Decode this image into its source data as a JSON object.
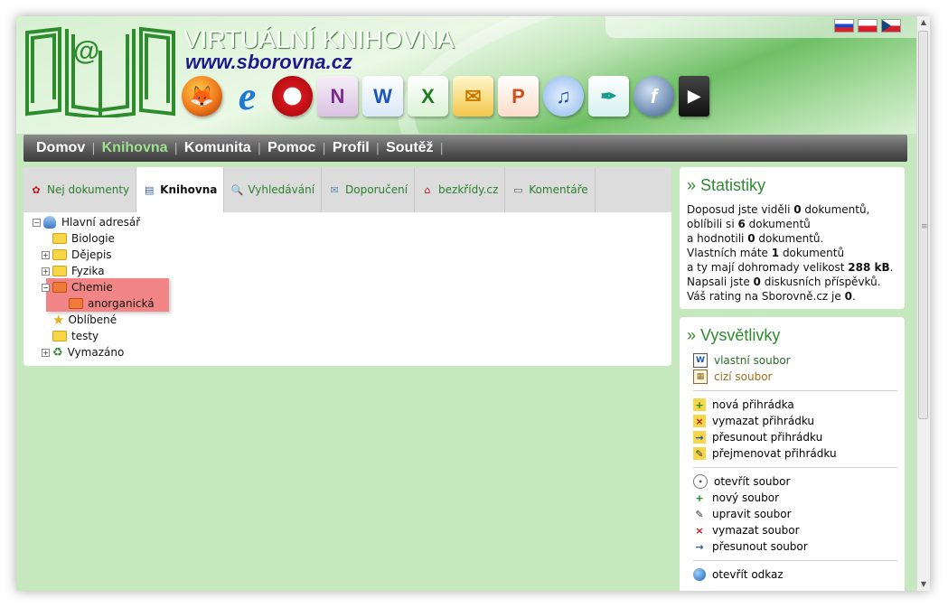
{
  "header": {
    "site_title": "VIRTUÁLNÍ KNIHOVNA",
    "site_url": "www.sborovna.cz",
    "flags": [
      "slovak-flag",
      "polish-flag",
      "czech-flag"
    ],
    "apps": [
      "firefox-icon",
      "internet-explorer-icon",
      "opera-icon",
      "onenote-icon",
      "word-icon",
      "excel-icon",
      "outlook-icon",
      "powerpoint-icon",
      "itunes-icon",
      "quill-icon",
      "flash-icon",
      "avi-video-icon"
    ]
  },
  "nav": {
    "items": [
      "Domov",
      "Knihovna",
      "Komunita",
      "Pomoc",
      "Profil",
      "Soutěž"
    ],
    "separator": "|"
  },
  "tabs": [
    {
      "label": "Nej dokumenty",
      "icon": "award-icon"
    },
    {
      "label": "Knihovna",
      "icon": "book-icon"
    },
    {
      "label": "Vyhledávání",
      "icon": "search-icon"
    },
    {
      "label": "Doporučení",
      "icon": "envelope-icon"
    },
    {
      "label": "bezkřídy.cz",
      "icon": "house-icon"
    },
    {
      "label": "Komentáře",
      "icon": "comments-icon"
    }
  ],
  "tree": {
    "root": "Hlavní adresář",
    "nodes": [
      "Biologie",
      "Dějepis",
      "Fyzika",
      "Chemie",
      "anorganická",
      "Oblíbené",
      "testy",
      "Vymazáno"
    ]
  },
  "stats": {
    "title": "» Statistiky",
    "l1a": "Doposud jste viděli ",
    "l1b": "0",
    "l1c": " dokumentů,",
    "l2a": "oblíbili si ",
    "l2b": "6",
    "l2c": " dokumentů",
    "l3a": "a hodnotili ",
    "l3b": "0",
    "l3c": " dokumentů.",
    "l4a": "Vlastních máte ",
    "l4b": "1",
    "l4c": " dokumentů",
    "l5a": "a ty mají dohromady velikost ",
    "l5b": "288 kB",
    "l5c": ".",
    "l6a": "Napsali jste ",
    "l6b": "0",
    "l6c": " diskusních příspěvků.",
    "l7a": "Váš rating na Sborovně.cz je ",
    "l7b": "0",
    "l7c": "."
  },
  "legend": {
    "title": "» Vysvětlivky",
    "group1": [
      "vlastní soubor",
      "cizí soubor"
    ],
    "group2": [
      "nová přihrádka",
      "vymazat přihrádku",
      "přesunout přihrádku",
      "přejmenovat přihrádku"
    ],
    "group3": [
      "otevřít soubor",
      "nový soubor",
      "upravit soubor",
      "vymazat soubor",
      "přesunout soubor"
    ],
    "group4": [
      "otevřít odkaz"
    ]
  },
  "colors": {
    "accent_green": "#2f8a2f",
    "highlight_red": "#f07070",
    "own_file": "#2a6b2a",
    "foreign_file": "#a06a1a"
  }
}
